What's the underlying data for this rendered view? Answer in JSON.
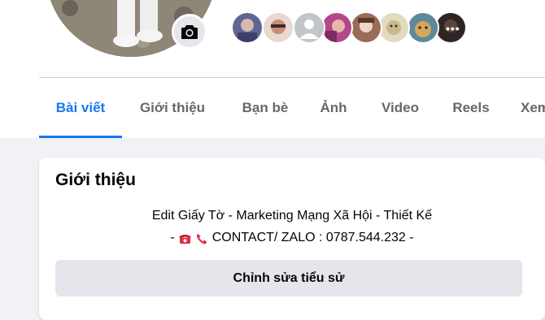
{
  "profile": {
    "camera_icon": "camera-icon",
    "friend_avatar_colors": [
      "#6b6f8c",
      "#c9a7a0",
      "#c2c5ca",
      "#b5478a",
      "#9a6b58",
      "#d8c9a0",
      "#8a6a4a",
      "#4a3a3a"
    ],
    "more_icon": "more-dots-icon"
  },
  "tabs": [
    {
      "label": "Bài viết",
      "active": true
    },
    {
      "label": "Giới thiệu"
    },
    {
      "label": "Bạn bè"
    },
    {
      "label": "Ảnh"
    },
    {
      "label": "Video"
    },
    {
      "label": "Reels"
    },
    {
      "label": "Xem"
    }
  ],
  "intro": {
    "title": "Giới thiệu",
    "bio_line1": "Edit Giấy Tờ - Marketing Mạng Xã Hội - Thiết Kế",
    "bio_prefix": "-",
    "bio_contact": "CONTACT/ ZALO : 0787.544.232 -",
    "edit_bio_label": "Chỉnh sửa tiểu sử"
  },
  "colors": {
    "accent": "#1877f2",
    "background": "#f0f2f5",
    "button_bg": "#e4e6eb"
  }
}
